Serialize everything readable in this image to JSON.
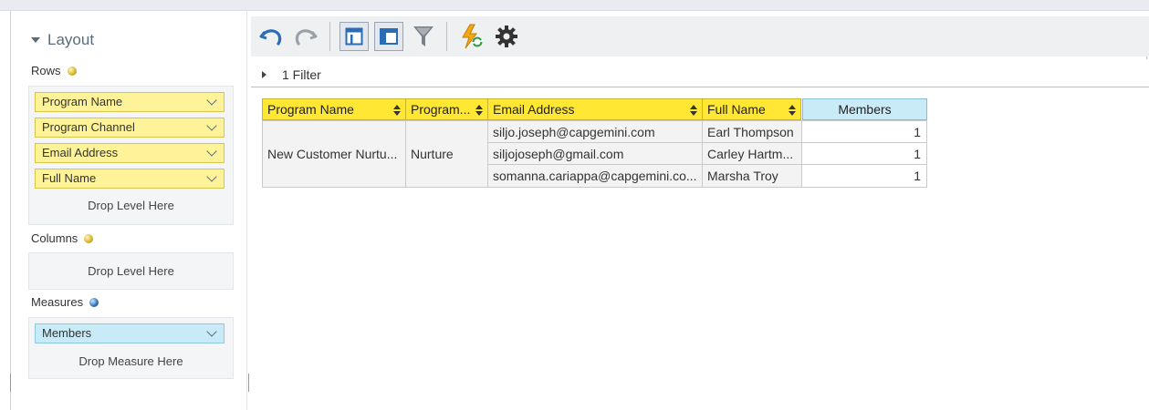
{
  "layout": {
    "title": "Layout",
    "rows": {
      "label": "Rows",
      "items": [
        "Program Name",
        "Program Channel",
        "Email Address",
        "Full Name"
      ],
      "drop_text": "Drop Level Here"
    },
    "columns": {
      "label": "Columns",
      "drop_text": "Drop Level Here"
    },
    "measures": {
      "label": "Measures",
      "items": [
        "Members"
      ],
      "drop_text": "Drop Measure Here"
    }
  },
  "toolbar": {
    "icons": [
      "undo-icon",
      "redo-icon",
      "compact-layout-icon",
      "tabular-layout-icon",
      "filter-icon",
      "refresh-data-icon",
      "settings-icon"
    ]
  },
  "filter": {
    "label": "1 Filter"
  },
  "grid": {
    "headers": [
      "Program Name",
      "Program...",
      "Email Address",
      "Full Name",
      "Members"
    ],
    "program_name": "New Customer Nurtu...",
    "program_channel": "Nurture",
    "rows": [
      {
        "email": "siljo.joseph@capgemini.com",
        "full_name": "Earl Thompson",
        "members": "1"
      },
      {
        "email": "siljojoseph@gmail.com",
        "full_name": "Carley Hartm...",
        "members": "1"
      },
      {
        "email": "somanna.cariappa@capgemini.co...",
        "full_name": "Marsha Troy",
        "members": "1"
      }
    ]
  },
  "colors": {
    "row_field": "#fff399",
    "header_row": "#ffe733",
    "measure": "#c9eaf7",
    "toolbar_bg": "#eef0f2",
    "accent_blue": "#2a6db5"
  }
}
